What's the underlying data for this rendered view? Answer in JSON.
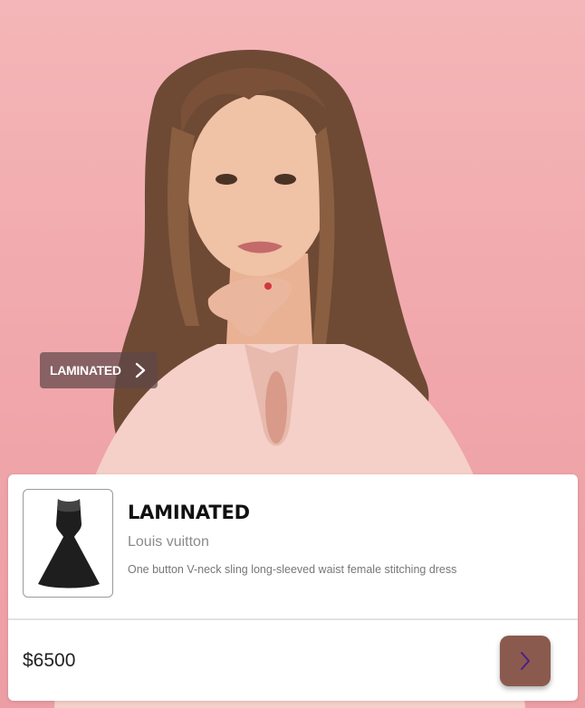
{
  "hero": {
    "image": "woman-in-pink-blouse-photo",
    "tag_label": "LAMINATED",
    "tag_icon": "chevron-right-icon"
  },
  "product": {
    "thumbnail": "black-dress-thumbnail",
    "title": "LAMINATED",
    "brand": "Louis vuitton",
    "description": "One button V-neck sling long-sleeved waist female stitching dress",
    "price": "$6500",
    "action_icon": "chevron-right-icon"
  },
  "colors": {
    "background": "#f2a9ad",
    "tag_bg": "#604648",
    "button_bg": "#8b5a4e",
    "button_icon": "#4a1f8a"
  }
}
